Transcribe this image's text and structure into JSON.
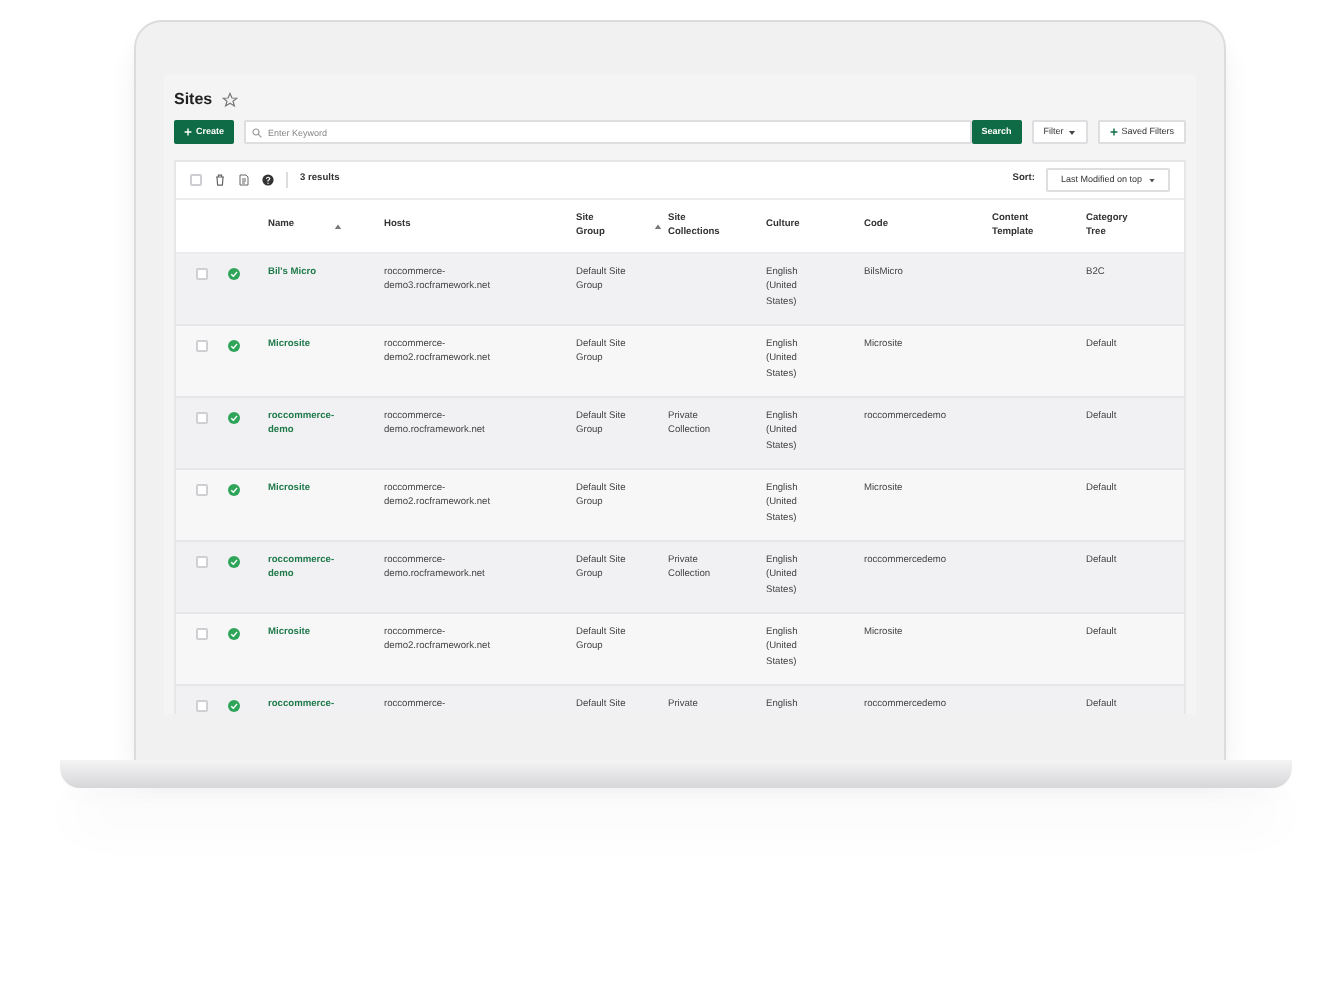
{
  "page": {
    "title": "Sites"
  },
  "toolbar": {
    "create_label": "Create",
    "search_placeholder": "Enter Keyword",
    "search_label": "Search",
    "filter_label": "Filter",
    "saved_filters_label": "Saved Filters"
  },
  "results": {
    "select_all_checked": false,
    "count": "3 results",
    "sort_label": "Sort:",
    "sort_value": "Last Modified on top"
  },
  "table": {
    "columns": [
      {
        "label": "Name",
        "sorted": true
      },
      {
        "label": "Hosts",
        "sorted": false
      },
      {
        "label": "Site Group",
        "sorted": true
      },
      {
        "label": "Site Collections",
        "sorted": false
      },
      {
        "label": "Culture",
        "sorted": false
      },
      {
        "label": "Code",
        "sorted": false
      },
      {
        "label": "Content Template",
        "sorted": false
      },
      {
        "label": "Category Tree",
        "sorted": false
      }
    ],
    "rows": [
      {
        "checked": false,
        "cells": [
          "Bil's Micro",
          "roccommerce-demo3.rocframework.net",
          "Default Site Group",
          "",
          "English (United States)",
          "BilsMicro",
          "",
          "B2C"
        ]
      },
      {
        "checked": false,
        "cells": [
          "Microsite",
          "roccommerce-demo2.rocframework.net",
          "Default Site Group",
          "",
          "English (United States)",
          "Microsite",
          "",
          "Default"
        ]
      },
      {
        "checked": false,
        "cells": [
          "roccommerce-demo",
          "roccommerce-demo.rocframework.net",
          "Default Site Group",
          "Private Collection",
          "English (United States)",
          "roccommercedemo",
          "",
          "Default"
        ]
      },
      {
        "checked": false,
        "cells": [
          "Microsite",
          "roccommerce-demo2.rocframework.net",
          "Default Site Group",
          "",
          "English (United States)",
          "Microsite",
          "",
          "Default"
        ]
      },
      {
        "checked": false,
        "cells": [
          "roccommerce-demo",
          "roccommerce-demo.rocframework.net",
          "Default Site Group",
          "Private Collection",
          "English (United States)",
          "roccommercedemo",
          "",
          "Default"
        ]
      },
      {
        "checked": false,
        "cells": [
          "Microsite",
          "roccommerce-demo2.rocframework.net",
          "Default Site Group",
          "",
          "English (United States)",
          "Microsite",
          "",
          "Default"
        ]
      },
      {
        "checked": false,
        "cells": [
          "roccommerce-",
          "roccommerce-",
          "Default Site",
          "Private",
          "English",
          "roccommercedemo",
          "",
          "Default"
        ]
      }
    ]
  }
}
